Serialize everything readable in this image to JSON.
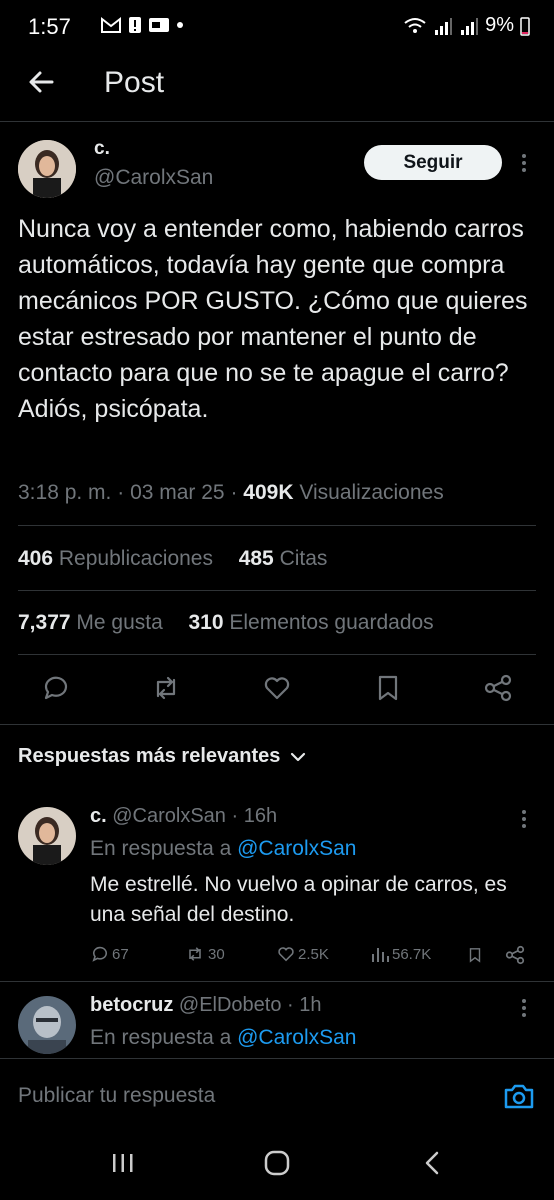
{
  "status_bar": {
    "time": "1:57",
    "battery": "9%"
  },
  "header": {
    "title": "Post"
  },
  "post": {
    "author_name": "c.",
    "author_handle": "@CarolxSan",
    "follow_label": "Seguir",
    "text": "Nunca voy a entender como, habiendo carros automáticos, todavía hay gente que compra mecánicos POR GUSTO. ¿Cómo que quieres estar estresado por mantener el punto de contacto para que no se te apague el carro? Adiós, psicópata.",
    "time": "3:18 p. m.",
    "date": "03 mar 25",
    "views_count": "409K",
    "views_label": "Visualizaciones",
    "reposts_count": "406",
    "reposts_label": "Republicaciones",
    "quotes_count": "485",
    "quotes_label": "Citas",
    "likes_count": "7,377",
    "likes_label": "Me gusta",
    "bookmarks_count": "310",
    "bookmarks_label": "Elementos guardados"
  },
  "replies_section": {
    "title": "Respuestas más relevantes"
  },
  "replies": [
    {
      "name": "c.",
      "handle": "@CarolxSan",
      "age": "16h",
      "in_reply_prefix": "En respuesta a",
      "in_reply_to": "@CarolxSan",
      "text": "Me estrellé. No vuelvo a opinar de carros, es una señal del destino.",
      "replies": "67",
      "reposts": "30",
      "likes": "2.5K",
      "views": "56.7K"
    },
    {
      "name": "betocruz",
      "handle": "@ElDobeto",
      "age": "1h",
      "in_reply_prefix": "En respuesta a",
      "in_reply_to": "@CarolxSan"
    }
  ],
  "compose": {
    "placeholder": "Publicar tu respuesta"
  },
  "icons": [
    "back-arrow-icon",
    "more-icon",
    "reply-icon",
    "repost-icon",
    "like-icon",
    "bookmark-icon",
    "share-icon",
    "chevron-down-icon",
    "views-icon",
    "camera-icon"
  ],
  "colors": {
    "background": "#000000",
    "text": "#e7e9ea",
    "muted": "#71767b",
    "link": "#1d9bf0"
  }
}
